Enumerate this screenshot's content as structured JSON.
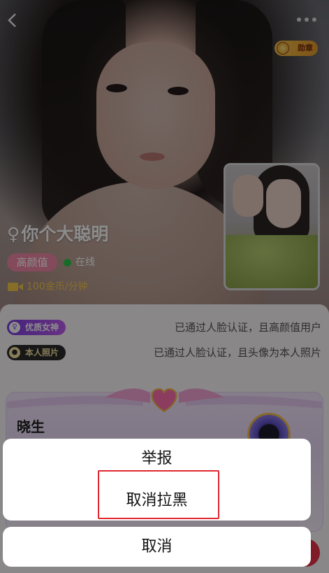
{
  "header": {
    "back_icon": "chevron-left-icon",
    "more_icon": "more-dots-icon",
    "medal_label": "勋章"
  },
  "profile": {
    "gender_symbol": "♀",
    "name": "你个大聪明",
    "tag": "高颜值",
    "status": "在线",
    "status_color": "#2ec34a",
    "price": "100金币/分钟"
  },
  "badges": [
    {
      "label": "优质女神",
      "description": "已通过人脸认证，且高颜值用户"
    },
    {
      "label": "本人照片",
      "description": "已通过人脸认证，且头像为本人照片"
    }
  ],
  "card": {
    "name": "晓生"
  },
  "action_sheet": {
    "items": [
      "举报",
      "取消拉黑"
    ],
    "cancel": "取消"
  },
  "colors": {
    "highlight": "#e0262f",
    "tag_pink": "#ee88a6",
    "price_gold": "#f6c94a"
  }
}
